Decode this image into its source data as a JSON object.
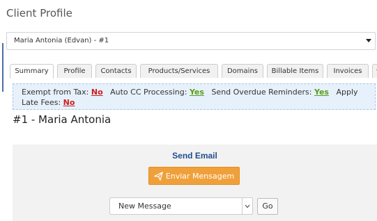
{
  "page": {
    "title": "Client Profile"
  },
  "client_selector": {
    "value": "Maria Antonia (Edvan) - #1"
  },
  "tabs": [
    {
      "label": "Summary",
      "active": true
    },
    {
      "label": "Profile"
    },
    {
      "label": "Contacts"
    },
    {
      "label": "Products/Services"
    },
    {
      "label": "Domains"
    },
    {
      "label": "Billable Items"
    },
    {
      "label": "Invoices"
    }
  ],
  "info": {
    "exempt_label": "Exempt from Tax:",
    "exempt_value": "No",
    "autocc_label": "Auto CC Processing:",
    "autocc_value": "Yes",
    "reminders_label": "Send Overdue Reminders:",
    "reminders_value": "Yes",
    "latefees_label": "Apply Late Fees:",
    "latefees_value": "No"
  },
  "client": {
    "heading": "#1 - Maria Antonia"
  },
  "send_email": {
    "title": "Send Email",
    "button_label": "Enviar Mensagem",
    "template_select": "New Message",
    "go_label": "Go"
  },
  "colors": {
    "accent_orange": "#f0a03a",
    "yes_green": "#5a9c1c",
    "no_red": "#cc1c1c",
    "info_bg": "#e7f1fb",
    "title_blue": "#1f4e8c"
  }
}
